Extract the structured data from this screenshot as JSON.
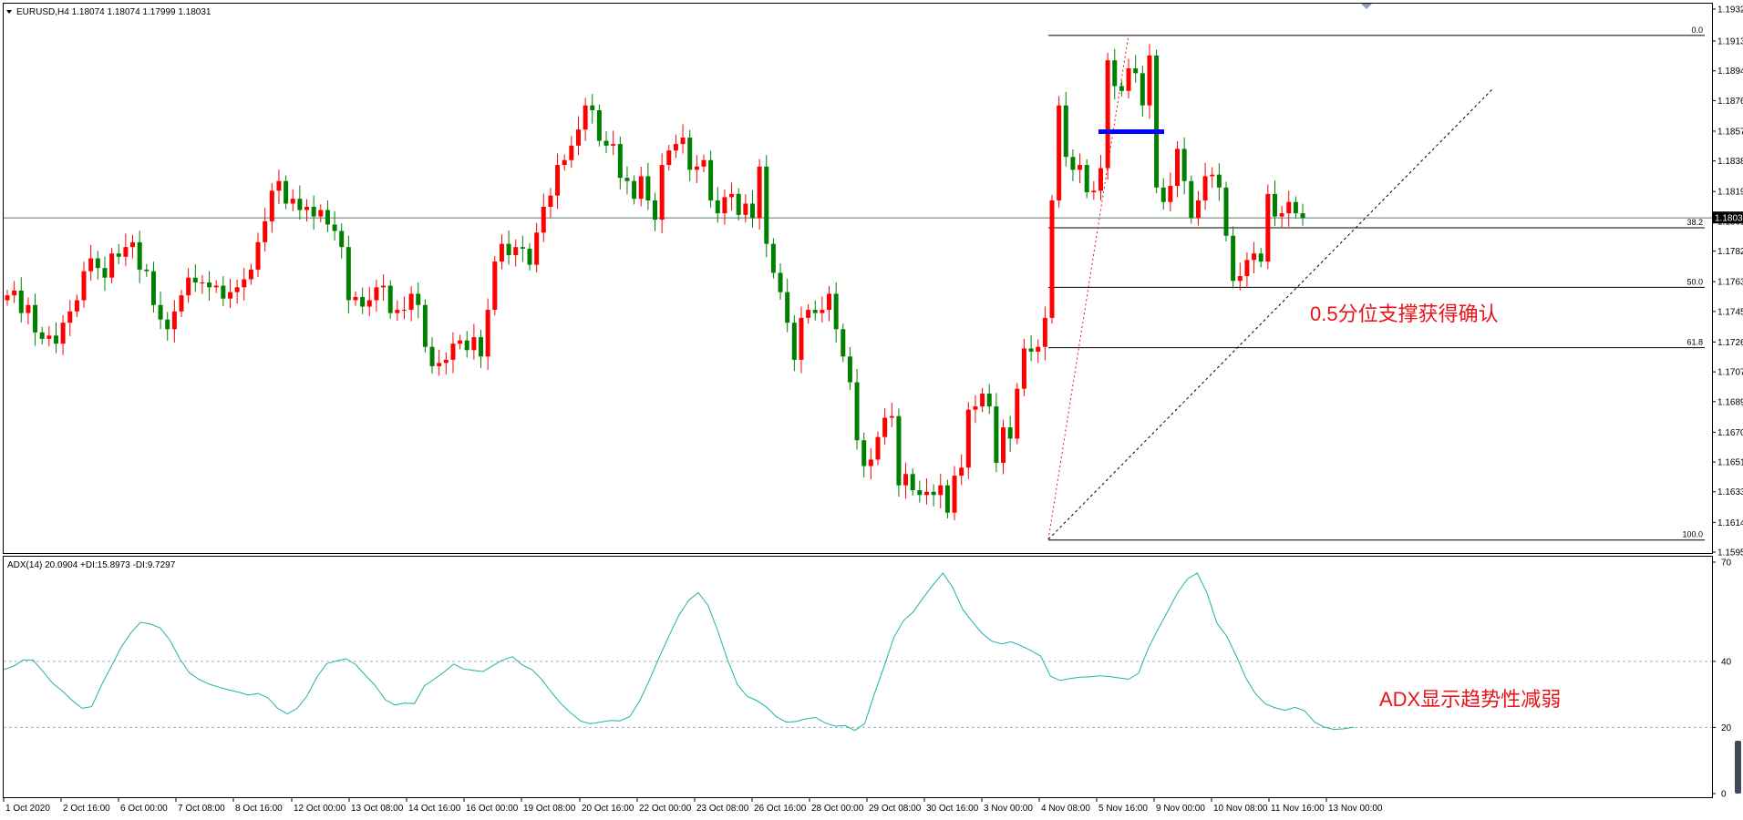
{
  "main": {
    "symbol_header": "EURUSD,H4  1.18074 1.18074 1.17999 1.18031",
    "current_price": "1.18031"
  },
  "indicator": {
    "header": "ADX(14) 20.0904 +DI:15.8973 -DI:9.7297"
  },
  "annotations": {
    "support": "0.5分位支撑获得确认",
    "adx": "ADX显示趋势性减弱"
  },
  "colors": {
    "bull": "#ff0000",
    "bear": "#008000",
    "adx_line": "#20b2aa",
    "blue_bar": "#0000ff",
    "annotation": "#e8141a"
  },
  "chart_data": [
    {
      "type": "candlestick",
      "title": "EURUSD,H4",
      "ohlc_header": [
        1.18074,
        1.18074,
        1.17999,
        1.18031
      ],
      "y_ticks": [
        1.1932,
        1.1913,
        1.18945,
        1.1876,
        1.1857,
        1.18385,
        1.18195,
        1.1801,
        1.17825,
        1.17635,
        1.1745,
        1.1726,
        1.17075,
        1.1689,
        1.167,
        1.16515,
        1.1633,
        1.1614,
        1.15955
      ],
      "ylim": [
        1.15955,
        1.1932
      ],
      "x_labels": [
        "1 Oct 2020",
        "2 Oct 16:00",
        "6 Oct 00:00",
        "7 Oct 08:00",
        "8 Oct 16:00",
        "12 Oct 00:00",
        "13 Oct 08:00",
        "14 Oct 16:00",
        "16 Oct 00:00",
        "19 Oct 08:00",
        "20 Oct 16:00",
        "22 Oct 00:00",
        "23 Oct 08:00",
        "26 Oct 16:00",
        "28 Oct 00:00",
        "29 Oct 08:00",
        "30 Oct 16:00",
        "3 Nov 00:00",
        "4 Nov 08:00",
        "5 Nov 16:00",
        "9 Nov 00:00",
        "10 Nov 08:00",
        "11 Nov 16:00",
        "13 Nov 00:00"
      ],
      "current_price": 1.18031,
      "current_price_label": "1.18031",
      "fibonacci": {
        "levels": [
          {
            "label": "0.0",
            "price": 1.19165
          },
          {
            "label": "38.2",
            "price": 1.1797
          },
          {
            "label": "50.0",
            "price": 1.176
          },
          {
            "label": "61.8",
            "price": 1.17225
          },
          {
            "label": "100.0",
            "price": 1.1603
          }
        ]
      },
      "closes": [
        1.1755,
        1.1758,
        1.1744,
        1.1749,
        1.1732,
        1.1728,
        1.173,
        1.1725,
        1.1738,
        1.1745,
        1.1752,
        1.177,
        1.1778,
        1.1772,
        1.1766,
        1.1781,
        1.1779,
        1.1785,
        1.1788,
        1.1771,
        1.177,
        1.1749,
        1.174,
        1.1734,
        1.1745,
        1.1755,
        1.1766,
        1.1763,
        1.1763,
        1.176,
        1.1761,
        1.1753,
        1.1757,
        1.176,
        1.1765,
        1.1771,
        1.1788,
        1.1801,
        1.182,
        1.1826,
        1.1812,
        1.1815,
        1.1808,
        1.181,
        1.1804,
        1.1808,
        1.1799,
        1.1795,
        1.1785,
        1.1752,
        1.1754,
        1.1748,
        1.1752,
        1.176,
        1.1761,
        1.1744,
        1.1746,
        1.1746,
        1.1756,
        1.1749,
        1.1723,
        1.1711,
        1.1713,
        1.1715,
        1.1725,
        1.1727,
        1.1721,
        1.1729,
        1.1717,
        1.1746,
        1.1776,
        1.1787,
        1.178,
        1.1785,
        1.1784,
        1.1774,
        1.1794,
        1.181,
        1.1817,
        1.1836,
        1.1839,
        1.1848,
        1.1858,
        1.1873,
        1.187,
        1.1851,
        1.1848,
        1.1849,
        1.1828,
        1.1826,
        1.1815,
        1.1829,
        1.1814,
        1.1802,
        1.1836,
        1.1845,
        1.1849,
        1.1853,
        1.1833,
        1.1835,
        1.1839,
        1.1814,
        1.1806,
        1.1816,
        1.1818,
        1.1805,
        1.1812,
        1.1803,
        1.1835,
        1.1787,
        1.1769,
        1.1757,
        1.1738,
        1.1715,
        1.1741,
        1.1746,
        1.1744,
        1.1746,
        1.1756,
        1.1734,
        1.1717,
        1.1701,
        1.1665,
        1.1649,
        1.1653,
        1.1667,
        1.1679,
        1.168,
        1.1637,
        1.1644,
        1.1634,
        1.1631,
        1.1633,
        1.1631,
        1.1637,
        1.162,
        1.1643,
        1.1648,
        1.1684,
        1.1686,
        1.1694,
        1.1686,
        1.1651,
        1.1673,
        1.1666,
        1.1697,
        1.1722,
        1.172,
        1.1723,
        1.1741,
        1.1814,
        1.1873,
        1.1841,
        1.1833,
        1.1836,
        1.1819,
        1.182,
        1.1834,
        1.1901,
        1.1885,
        1.1882,
        1.1896,
        1.1893,
        1.1873,
        1.1904,
        1.1822,
        1.1813,
        1.1823,
        1.1846,
        1.1826,
        1.1803,
        1.1814,
        1.1829,
        1.183,
        1.1822,
        1.1792,
        1.1764,
        1.1767,
        1.1777,
        1.1781,
        1.1776,
        1.1818,
        1.1804,
        1.1806,
        1.1813,
        1.1806,
        1.1803
      ]
    },
    {
      "type": "line",
      "title": "ADX(14)",
      "header_values": {
        "ADX": 20.0904,
        "+DI": 15.8973,
        "-DI": 9.7297
      },
      "y_ticks": [
        70,
        40,
        20,
        0
      ],
      "ylim": [
        0,
        70
      ],
      "levels": [
        40,
        20
      ],
      "series": [
        {
          "name": "ADX(14)",
          "values": [
            37.5,
            38.5,
            40.4,
            40.4,
            37.0,
            33.4,
            31.0,
            28.2,
            25.8,
            26.3,
            32.8,
            38.5,
            44.2,
            48.6,
            51.8,
            51.3,
            50.1,
            46.4,
            40.8,
            36.5,
            34.5,
            33.1,
            32.2,
            31.4,
            30.7,
            29.8,
            30.3,
            29.0,
            25.8,
            24.1,
            25.8,
            29.5,
            35.1,
            39.3,
            40.1,
            40.8,
            39.0,
            35.7,
            32.6,
            28.4,
            26.8,
            27.4,
            27.2,
            32.6,
            34.6,
            36.7,
            39.2,
            37.7,
            37.3,
            36.9,
            38.7,
            40.4,
            41.4,
            38.9,
            37.5,
            34.5,
            30.6,
            27.1,
            24.3,
            21.9,
            21.1,
            21.6,
            22.1,
            22.0,
            23.3,
            28.0,
            34.3,
            41.1,
            47.7,
            53.8,
            58.4,
            60.8,
            56.9,
            49.2,
            40.4,
            33.0,
            29.4,
            28.1,
            26.1,
            23.2,
            21.6,
            21.8,
            22.6,
            23.0,
            21.3,
            20.4,
            20.6,
            19.1,
            21.1,
            30.1,
            38.5,
            47.3,
            52.4,
            55.0,
            59.3,
            63.1,
            66.7,
            62.4,
            55.9,
            52.0,
            48.5,
            46.1,
            45.3,
            45.9,
            44.7,
            43.3,
            41.6,
            35.5,
            34.2,
            34.8,
            35.2,
            35.3,
            35.6,
            35.4,
            35.0,
            34.6,
            36.4,
            43.9,
            49.8,
            55.2,
            60.8,
            64.9,
            66.7,
            60.7,
            51.6,
            47.7,
            41.6,
            34.8,
            30.0,
            27.1,
            25.9,
            25.2,
            26.1,
            25.0,
            21.6,
            20.1,
            19.4,
            19.6,
            20.1
          ]
        }
      ]
    }
  ]
}
